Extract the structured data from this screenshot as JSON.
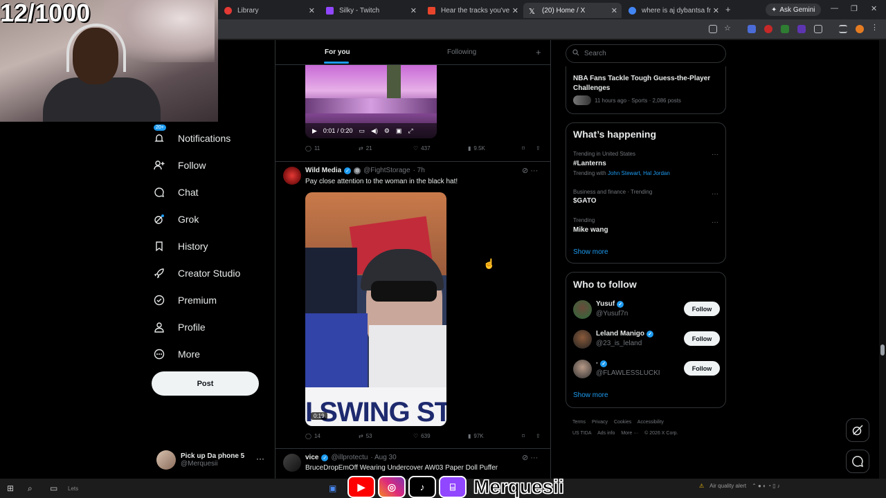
{
  "browser": {
    "tabs": [
      {
        "title": "Library",
        "color": "#e53935"
      },
      {
        "title": "Silky - Twitch",
        "color": "#9146ff"
      },
      {
        "title": "Hear the tracks you've liked",
        "color": "#e8452c"
      },
      {
        "title": "(20) Home / X",
        "color": "#ffffff"
      },
      {
        "title": "where is aj dybantsa from",
        "color": "#4285f4"
      }
    ],
    "gemini_label": "Ask Gemini"
  },
  "webcam": {
    "counter": "12/1000"
  },
  "nav": {
    "badge": "20+",
    "items": [
      {
        "label": "Notifications"
      },
      {
        "label": "Follow"
      },
      {
        "label": "Chat"
      },
      {
        "label": "Grok"
      },
      {
        "label": "History"
      },
      {
        "label": "Creator Studio"
      },
      {
        "label": "Premium"
      },
      {
        "label": "Profile"
      },
      {
        "label": "More"
      }
    ],
    "post_label": "Post"
  },
  "account": {
    "name": "Pick up Da phone 5",
    "handle": "@Merquesii"
  },
  "timeline": {
    "tabs": {
      "for_you": "For you",
      "following": "Following"
    },
    "video1": {
      "time": "0:01 / 0:20"
    },
    "post1_actions": {
      "replies": "11",
      "reposts": "21",
      "likes": "437",
      "views": "9.5K"
    },
    "post2": {
      "name": "Wild Media",
      "handle": "@FightStorage",
      "time": "· 7h",
      "text": "Pay close attention to the woman in the black hat!",
      "video_time": "0:19",
      "video_caption": "I SWING ST",
      "actions": {
        "replies": "14",
        "reposts": "53",
        "likes": "639",
        "views": "97K"
      }
    },
    "post3": {
      "name": "vice",
      "handle": "@illprotectu",
      "time": "· Aug 30",
      "text": "BruceDropEmOff Wearing Undercover AW03 Paper Doll Puffer"
    }
  },
  "sidebar": {
    "search_placeholder": "Search",
    "top_news": {
      "title": "NBA Fans Tackle Tough Guess-the-Player Challenges",
      "meta": "11 hours ago · Sports · 2,086 posts"
    },
    "happening": {
      "title": "What’s happening",
      "trends": [
        {
          "category": "Trending in United States",
          "name": "#Lanterns",
          "with_prefix": "Trending with",
          "with_links": "John Stewart, Hal Jordan"
        },
        {
          "category": "Business and finance · Trending",
          "name": "$GATO"
        },
        {
          "category": "Trending",
          "name": "Mike wang"
        }
      ],
      "show_more": "Show more"
    },
    "who_to_follow": {
      "title": "Who to follow",
      "users": [
        {
          "name": "Yusuf",
          "handle": "@Yusuf7n",
          "button": "Follow"
        },
        {
          "name": "Leland Manigo",
          "handle": "@23_is_leland",
          "button": "Follow"
        },
        {
          "name": "·",
          "handle": "@FLAWLESSLUCKI",
          "button": "Follow"
        }
      ],
      "show_more": "Show more"
    },
    "footer": [
      "Terms",
      "Privacy",
      "Cookies",
      "Accessibility",
      "US TIDA",
      "Ads info",
      "More ···",
      "© 2026 X Corp."
    ]
  },
  "overlay": {
    "brand": "Merquesii"
  },
  "taskbar": {
    "search_text": "Lets",
    "alert": "Air quality alert"
  },
  "colors": {
    "accent": "#1d9bf0",
    "background": "#000000",
    "border": "#2f3336"
  }
}
